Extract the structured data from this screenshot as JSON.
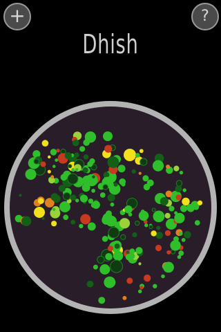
{
  "app": {
    "title": "Dhish"
  },
  "toolbar": {
    "add_glyph": "+",
    "help_glyph": "?"
  },
  "colors": {
    "background": "#000000",
    "dish_rim": "#b3b3b3",
    "dish_fill": "#281d29",
    "button_fill": "#4a4a4a",
    "button_border": "#9a9a9a",
    "title_text": "#cfcfcf",
    "cell_green": "#2fbf2a",
    "cell_dark_green": "#145f17",
    "cell_yellow": "#f2e11a",
    "cell_orange": "#e08020",
    "cell_red": "#c83a20"
  },
  "dish": {
    "cell_count": 244,
    "cell_color_classes": [
      "green",
      "dark-green",
      "yellow-green",
      "yellow",
      "orange",
      "red"
    ]
  }
}
